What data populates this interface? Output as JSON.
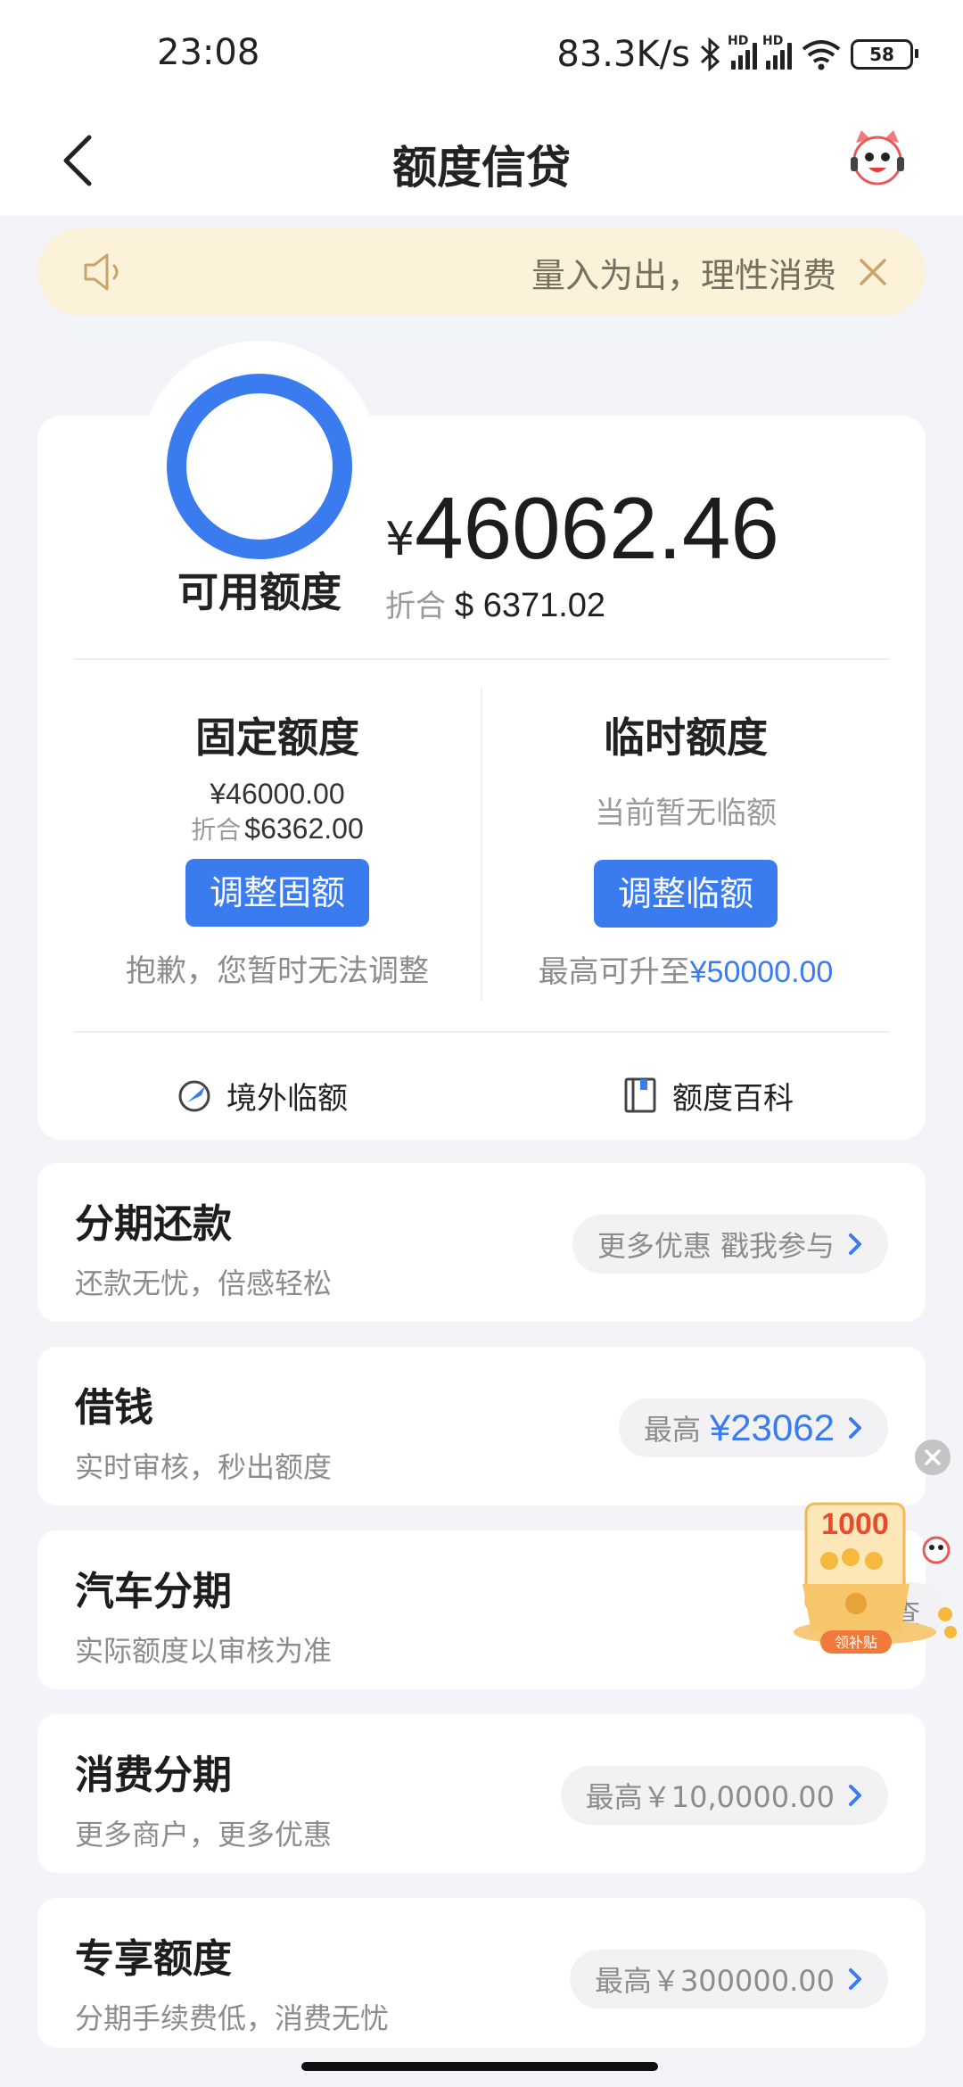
{
  "status": {
    "time": "23:08",
    "net_speed": "83.3K/s",
    "hd1": "HD",
    "hd2": "HD",
    "battery": "58"
  },
  "header": {
    "title": "额度信贷",
    "back_icon": "chevron-left-icon",
    "service_icon": "customer-service-mascot-icon"
  },
  "notice": {
    "text": "量入为出，理性消费",
    "speaker_icon": "speaker-icon",
    "close_icon": "close-icon",
    "bg_color": "#fcf2d9"
  },
  "credit": {
    "available_label": "可用额度",
    "currency_symbol": "¥",
    "available_amount": "46062.46",
    "usd_label": "折合",
    "usd_amount": "$ 6371.02",
    "fixed": {
      "title": "固定额度",
      "amount_cny": "¥46000.00",
      "usd_label": "折合",
      "amount_usd": "$6362.00",
      "button": "调整固额",
      "note": "抱歉，您暂时无法调整"
    },
    "temporary": {
      "title": "临时额度",
      "status": "当前暂无临额",
      "button": "调整临额",
      "note_prefix": "最高可升至",
      "note_amount": "¥50000.00"
    },
    "links": [
      {
        "label": "境外临额",
        "icon": "globe-plane-icon"
      },
      {
        "label": "额度百科",
        "icon": "book-icon"
      }
    ]
  },
  "services": [
    {
      "title": "分期还款",
      "subtitle": "还款无忧，倍感轻松",
      "pill_text": "更多优惠 戳我参与",
      "pill_amount": ""
    },
    {
      "title": "借钱",
      "subtitle": "实时审核，秒出额度",
      "pill_text": "最高",
      "pill_amount": "¥23062"
    },
    {
      "title": "汽车分期",
      "subtitle": "实际额度以审核为准",
      "pill_text": "点击查",
      "pill_amount": ""
    },
    {
      "title": "消费分期",
      "subtitle": "更多商户，更多优惠",
      "pill_text": "最高￥10,0000.00",
      "pill_amount": ""
    },
    {
      "title": "专享额度",
      "subtitle": "分期手续费低，消费无忧",
      "pill_text": "最高￥300000.00",
      "pill_amount": ""
    }
  ],
  "floating_promo": {
    "amount": "1000",
    "label": "领补贴"
  },
  "colors": {
    "accent": "#3a7bf0",
    "background": "#f3f4f8"
  }
}
